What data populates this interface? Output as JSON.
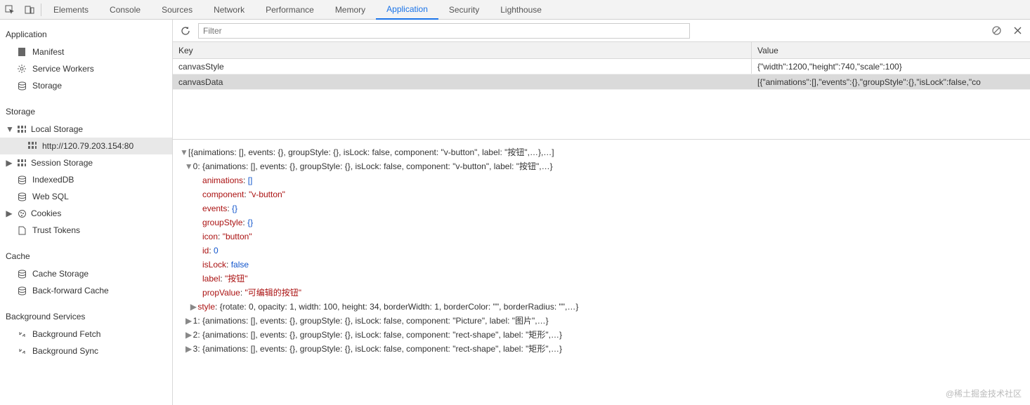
{
  "tabs": [
    "Elements",
    "Console",
    "Sources",
    "Network",
    "Performance",
    "Memory",
    "Application",
    "Security",
    "Lighthouse"
  ],
  "activeTab": "Application",
  "side": {
    "appHeader": "Application",
    "appItems": [
      {
        "icon": "manifest",
        "label": "Manifest"
      },
      {
        "icon": "gear",
        "label": "Service Workers"
      },
      {
        "icon": "db",
        "label": "Storage"
      }
    ],
    "storageHeader": "Storage",
    "localStorage": {
      "label": "Local Storage",
      "expanded": true,
      "child": "http://120.79.203.154:80"
    },
    "sessionStorage": {
      "label": "Session Storage",
      "expanded": false
    },
    "others": [
      {
        "icon": "db",
        "label": "IndexedDB"
      },
      {
        "icon": "db",
        "label": "Web SQL"
      },
      {
        "icon": "cookie",
        "label": "Cookies",
        "expandable": true
      },
      {
        "icon": "doc",
        "label": "Trust Tokens"
      }
    ],
    "cacheHeader": "Cache",
    "cacheItems": [
      {
        "icon": "db",
        "label": "Cache Storage"
      },
      {
        "icon": "db",
        "label": "Back-forward Cache"
      }
    ],
    "bgHeader": "Background Services",
    "bgItems": [
      {
        "icon": "sync",
        "label": "Background Fetch"
      },
      {
        "icon": "sync",
        "label": "Background Sync"
      }
    ]
  },
  "toolbar": {
    "filterPlaceholder": "Filter"
  },
  "table": {
    "keyHeader": "Key",
    "valueHeader": "Value",
    "rows": [
      {
        "key": "canvasStyle",
        "value": "{\"width\":1200,\"height\":740,\"scale\":100}"
      },
      {
        "key": "canvasData",
        "value": "[{\"animations\":[],\"events\":{},\"groupStyle\":{},\"isLock\":false,\"co"
      }
    ],
    "selected": 1
  },
  "viewer": {
    "root": "[{animations: [], events: {}, groupStyle: {}, isLock: false, component: \"v-button\", label: \"按钮\",…},…]",
    "item0": "0: {animations: [], events: {}, groupStyle: {}, isLock: false, component: \"v-button\", label: \"按钮\",…}",
    "props": [
      {
        "k": "animations",
        "v": "[]",
        "t": "n"
      },
      {
        "k": "component",
        "v": "\"v-button\"",
        "t": "s"
      },
      {
        "k": "events",
        "v": "{}",
        "t": "n"
      },
      {
        "k": "groupStyle",
        "v": "{}",
        "t": "n"
      },
      {
        "k": "icon",
        "v": "\"button\"",
        "t": "s"
      },
      {
        "k": "id",
        "v": "0",
        "t": "n"
      },
      {
        "k": "isLock",
        "v": "false",
        "t": "b"
      },
      {
        "k": "label",
        "v": "\"按钮\"",
        "t": "s"
      },
      {
        "k": "propValue",
        "v": "\"可编辑的按钮\"",
        "t": "s"
      }
    ],
    "styleLine": "style: {rotate: 0, opacity: 1, width: 100, height: 34, borderWidth: 1, borderColor: \"\", borderRadius: \"\",…}",
    "rest": [
      "1: {animations: [], events: {}, groupStyle: {}, isLock: false, component: \"Picture\", label: \"图片\",…}",
      "2: {animations: [], events: {}, groupStyle: {}, isLock: false, component: \"rect-shape\", label: \"矩形\",…}",
      "3: {animations: [], events: {}, groupStyle: {}, isLock: false, component: \"rect-shape\", label: \"矩形\",…}"
    ]
  },
  "watermark": "@稀土掘金技术社区"
}
